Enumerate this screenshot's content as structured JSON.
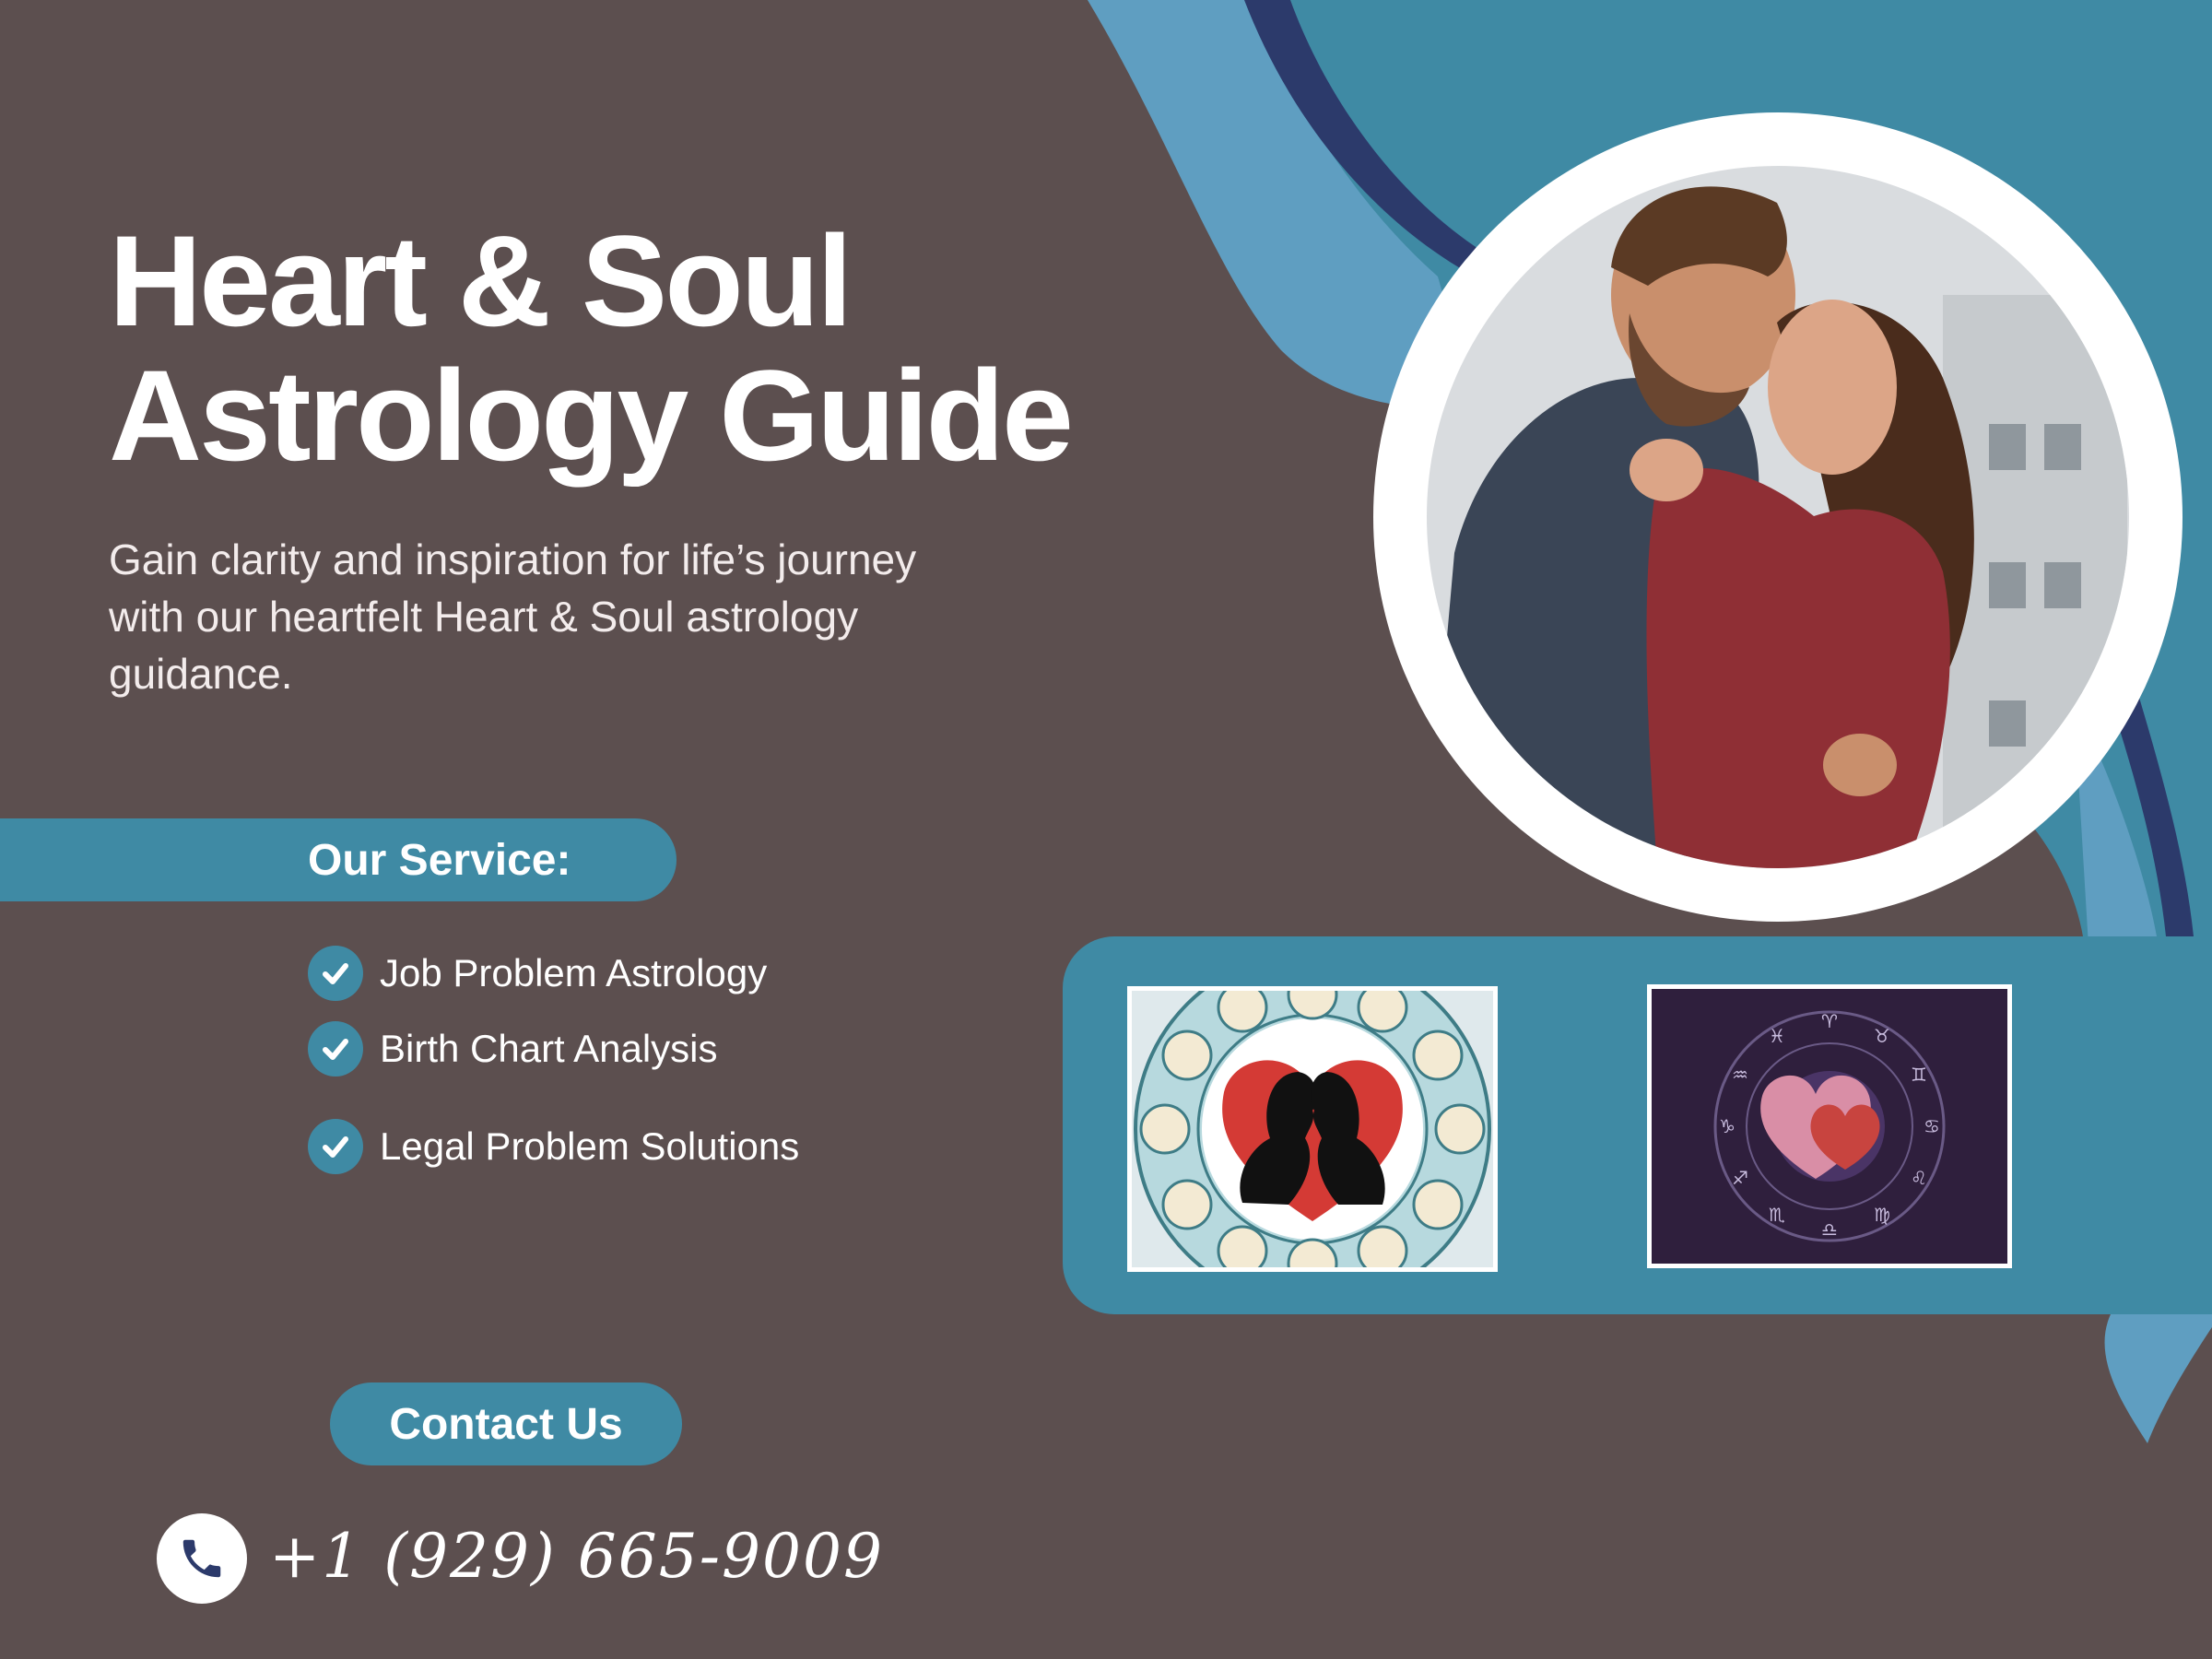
{
  "title": {
    "line1": "Heart & Soul",
    "line2": "Astrology Guide"
  },
  "subtitle": "Gain clarity and inspiration for life’s journey with our heartfelt Heart & Soul astrology guidance.",
  "services": {
    "heading": "Our Service:",
    "items": [
      {
        "label": "Job Problem Astrology"
      },
      {
        "label": "Birth Chart Analysis"
      },
      {
        "label": "Legal Problem Solutions"
      }
    ]
  },
  "contact": {
    "button_label": "Contact Us",
    "phone": "+1 (929) 665-9009"
  },
  "colors": {
    "background": "#5c4f4f",
    "accent_teal": "#3f8aa4",
    "light_blue": "#5f9ec1",
    "navy": "#2c3a6b",
    "text": "#ffffff"
  },
  "icons": [
    "check-icon",
    "phone-icon"
  ],
  "images": [
    "couple-photo",
    "zodiac-love-thumbnail",
    "zodiac-hearts-thumbnail"
  ]
}
